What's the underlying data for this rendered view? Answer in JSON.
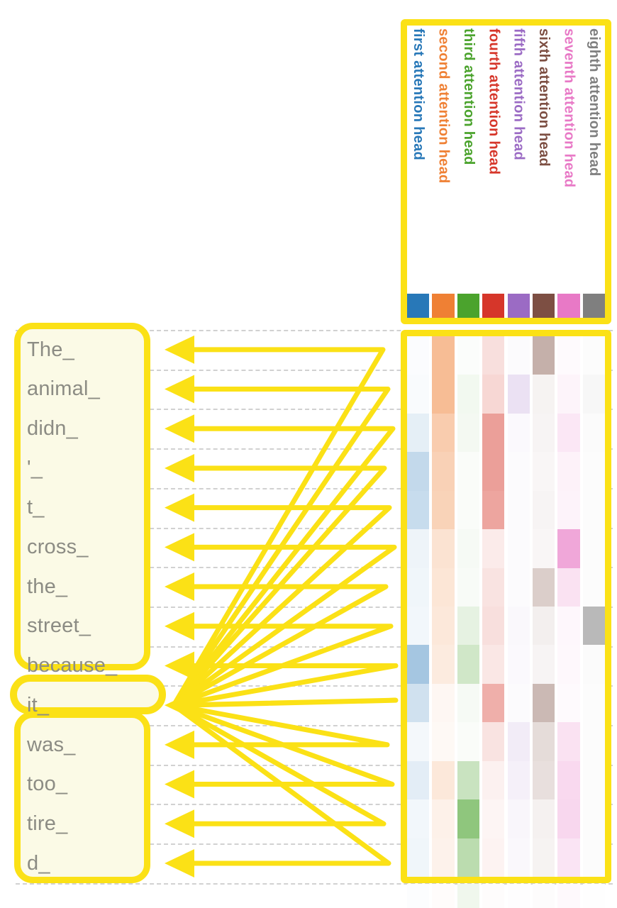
{
  "figure": {
    "kind": "attention-visualization",
    "accent_color": "#FBE116",
    "token_text_color": "#8C8C84",
    "focused_token": "it_"
  },
  "tokens": {
    "label": "input tokens",
    "items": [
      "The_",
      "animal_",
      "didn_",
      "'_",
      "t_",
      "cross_",
      "the_",
      "street_",
      "because_",
      "it_",
      "was_",
      "too_",
      "tire_",
      "d_"
    ],
    "focused_index": 9
  },
  "heads": {
    "columns": [
      {
        "label": "first attention head",
        "color": "#2878B8"
      },
      {
        "label": "second attention head",
        "color": "#EF8034"
      },
      {
        "label": "third attention head",
        "color": "#4BA32D"
      },
      {
        "label": "fourth attention head",
        "color": "#D6362A"
      },
      {
        "label": "fifth attention head",
        "color": "#9B6BC4"
      },
      {
        "label": "sixth attention head",
        "color": "#7D4F43"
      },
      {
        "label": "seventh attention head",
        "color": "#E879C6"
      },
      {
        "label": "eighth attention head",
        "color": "#7F7F7F"
      }
    ]
  },
  "chart_data": {
    "type": "heatmap",
    "title": "",
    "xlabel": "",
    "ylabel": "",
    "grid": true,
    "legend_position": "top",
    "x_categories": [
      "first attention head",
      "second attention head",
      "third attention head",
      "fourth attention head",
      "fifth attention head",
      "sixth attention head",
      "seventh attention head",
      "eighth attention head"
    ],
    "y_categories": [
      "The_",
      "animal_",
      "didn_",
      "'_",
      "t_",
      "cross_",
      "the_",
      "street_",
      "because_",
      "it_",
      "was_",
      "too_",
      "tire_",
      "d_"
    ],
    "colors": [
      "#2878B8",
      "#EF8034",
      "#4BA32D",
      "#D6362A",
      "#9B6BC4",
      "#7D4F43",
      "#E879C6",
      "#7F7F7F"
    ],
    "value_range": [
      0,
      1
    ],
    "series": [
      {
        "name": "first attention head",
        "values": [
          0.02,
          0.03,
          0.12,
          0.28,
          0.26,
          0.08,
          0.07,
          0.06,
          0.42,
          0.22,
          0.05,
          0.13,
          0.06,
          0.07
        ]
      },
      {
        "name": "second attention head",
        "values": [
          0.52,
          0.52,
          0.4,
          0.36,
          0.35,
          0.22,
          0.2,
          0.18,
          0.16,
          0.06,
          0.05,
          0.18,
          0.11,
          0.1
        ]
      },
      {
        "name": "third attention head",
        "values": [
          0.02,
          0.07,
          0.06,
          0.03,
          0.03,
          0.05,
          0.04,
          0.14,
          0.26,
          0.05,
          0.03,
          0.3,
          0.62,
          0.38
        ]
      },
      {
        "name": "fourth attention head",
        "values": [
          0.16,
          0.2,
          0.48,
          0.48,
          0.45,
          0.1,
          0.14,
          0.16,
          0.12,
          0.4,
          0.14,
          0.07,
          0.05,
          0.06
        ]
      },
      {
        "name": "fifth attention head",
        "values": [
          0.03,
          0.2,
          0.04,
          0.03,
          0.03,
          0.03,
          0.03,
          0.05,
          0.04,
          0.03,
          0.13,
          0.1,
          0.06,
          0.05
        ]
      },
      {
        "name": "sixth attention head",
        "values": [
          0.45,
          0.07,
          0.06,
          0.05,
          0.06,
          0.05,
          0.28,
          0.09,
          0.06,
          0.4,
          0.2,
          0.18,
          0.08,
          0.07
        ]
      },
      {
        "name": "seventh attention head",
        "values": [
          0.04,
          0.08,
          0.18,
          0.1,
          0.09,
          0.66,
          0.22,
          0.06,
          0.05,
          0.04,
          0.22,
          0.28,
          0.3,
          0.2
        ]
      },
      {
        "name": "eighth attention head",
        "values": [
          0.02,
          0.06,
          0.03,
          0.02,
          0.02,
          0.02,
          0.02,
          0.55,
          0.03,
          0.02,
          0.02,
          0.02,
          0.02,
          0.02
        ]
      }
    ]
  }
}
